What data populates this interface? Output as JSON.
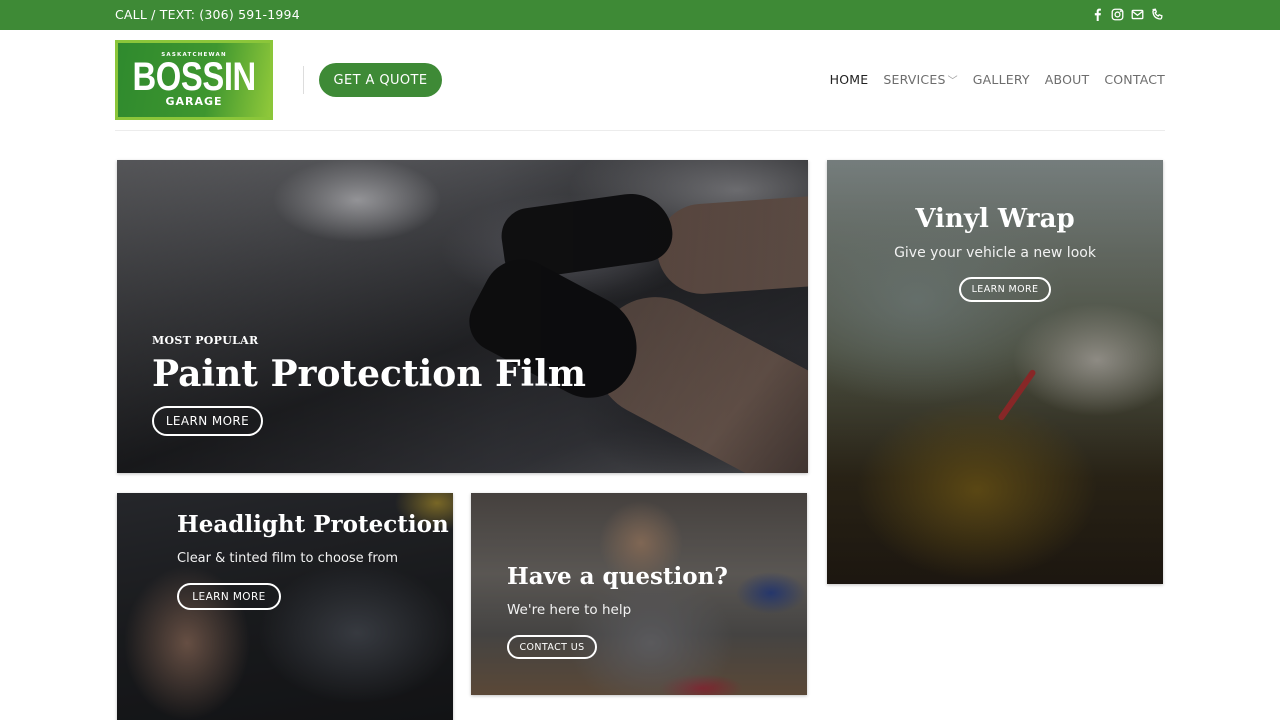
{
  "topbar": {
    "phone": "CALL / TEXT: (306) 591-1994",
    "social_icons": [
      "facebook-icon",
      "instagram-icon",
      "email-icon",
      "phone-icon"
    ],
    "background_color": "#3e8a36"
  },
  "header": {
    "logo": {
      "top": "SASKATCHEWAN",
      "main": "BOSSIN",
      "bottom": "GARAGE"
    },
    "quote_button": "GET A QUOTE",
    "nav": {
      "home": "HOME",
      "services": "SERVICES",
      "gallery": "GALLERY",
      "about": "ABOUT",
      "contact": "CONTACT"
    }
  },
  "tiles": {
    "ppf": {
      "eyebrow": "MOST POPULAR",
      "title": "Paint Protection Film",
      "button": "LEARN MORE"
    },
    "vinyl": {
      "title": "Vinyl Wrap",
      "subtitle": "Give your vehicle a new look",
      "button": "LEARN MORE"
    },
    "headlight": {
      "title": "Headlight Protection",
      "subtitle": "Clear & tinted film to choose from",
      "button": "LEARN MORE"
    },
    "question": {
      "title": "Have a question?",
      "subtitle": "We're here to help",
      "button": "CONTACT US"
    }
  }
}
